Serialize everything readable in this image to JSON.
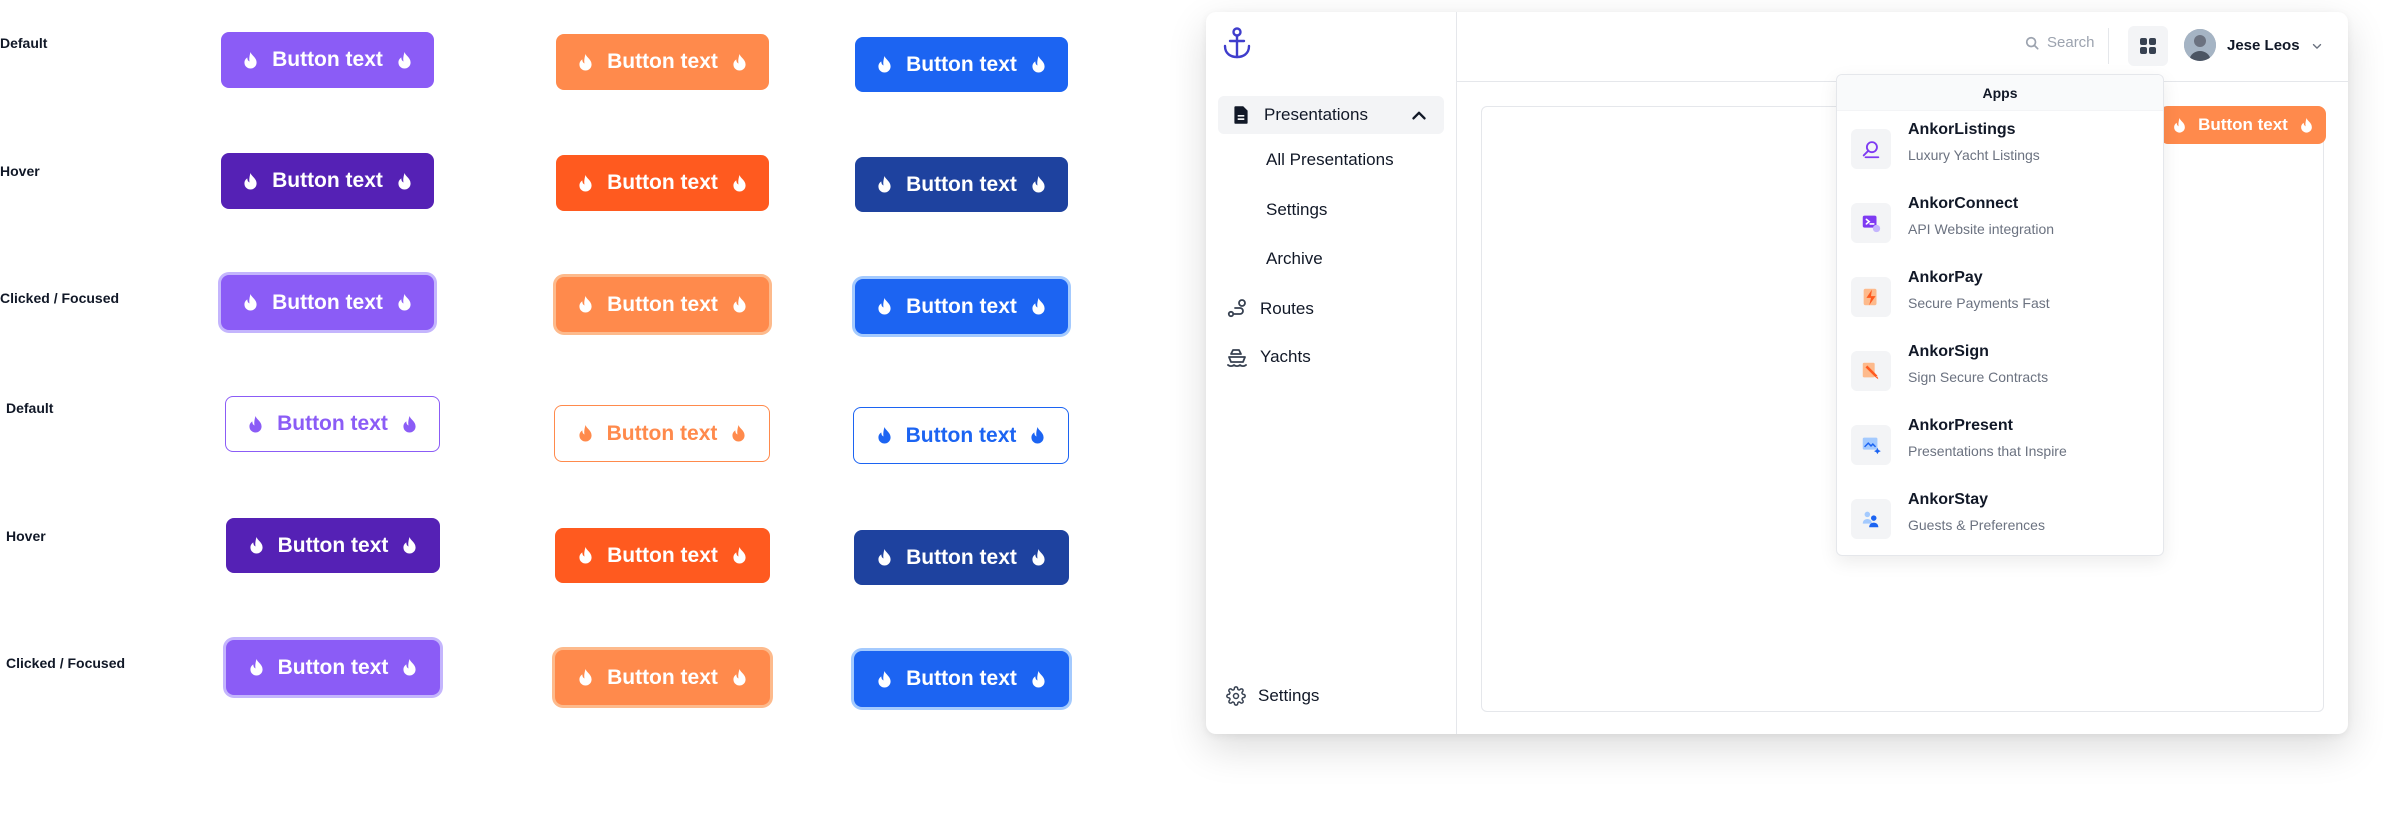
{
  "showcase": {
    "labels": {
      "default1": "Default",
      "hover1": "Hover",
      "focused1": "Clicked / Focused",
      "default2": "Default",
      "hover2": "Hover",
      "focused2": "Clicked / Focused"
    },
    "button_label": "Button text",
    "icon": "fire-icon",
    "colors": {
      "purple": "#8B5CF6",
      "purple_hover": "#5521B5",
      "orange": "#FF8A4C",
      "orange_hover": "#FF5A1F",
      "blue": "#1C64F2",
      "blue_hover": "#1E429F"
    }
  },
  "sidebar": {
    "logo": "anchor-icon",
    "presentations": "Presentations",
    "sub_items": [
      "All Presentations",
      "Settings",
      "Archive"
    ],
    "routes": "Routes",
    "yachts": "Yachts",
    "bottom_settings": "Settings"
  },
  "topbar": {
    "search_placeholder": "Search",
    "user_name": "Jese Leos"
  },
  "main": {
    "button_label": "Button text"
  },
  "apps_menu": {
    "title": "Apps",
    "items": [
      {
        "prefix": "Ankor",
        "name": "Listings",
        "desc": "Luxury Yacht Listings",
        "icon": "search-listing-icon"
      },
      {
        "prefix": "Ankor",
        "name": "Connect",
        "desc": "API Website integration",
        "icon": "terminal-icon"
      },
      {
        "prefix": "Ankor",
        "name": "Pay",
        "desc": "Secure Payments Fast",
        "icon": "lightning-card-icon"
      },
      {
        "prefix": "Ankor",
        "name": "Sign",
        "desc": "Sign Secure Contracts",
        "icon": "pen-sign-icon"
      },
      {
        "prefix": "Ankor",
        "name": "Present",
        "desc": "Presentations that Inspire",
        "icon": "presentation-icon"
      },
      {
        "prefix": "Ankor",
        "name": "Stay",
        "desc": "Guests & Preferences",
        "icon": "guests-icon"
      }
    ]
  }
}
